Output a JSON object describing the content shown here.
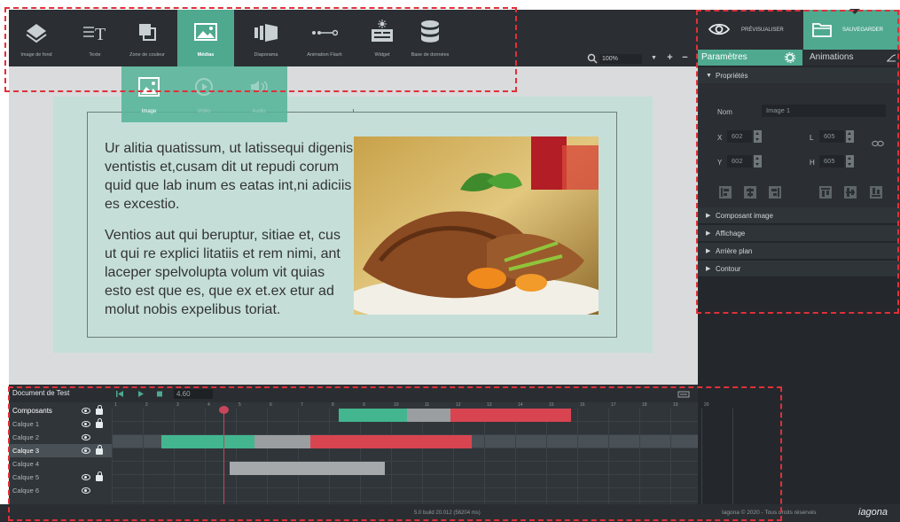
{
  "toolbar": {
    "tools": [
      {
        "label": "Image de fond",
        "icon": "layers-icon"
      },
      {
        "label": "Texte",
        "icon": "text-icon"
      },
      {
        "label": "Zone de couleur",
        "icon": "color-zone-icon"
      },
      {
        "label": "Médias",
        "icon": "media-icon"
      },
      {
        "label": "Diaporama",
        "icon": "slideshow-icon"
      },
      {
        "label": "Animation Flash",
        "icon": "flash-animation-icon"
      },
      {
        "label": "Widget",
        "icon": "widget-icon"
      },
      {
        "label": "Base de données",
        "icon": "database-icon"
      }
    ],
    "active_tool": "Médias",
    "zoom": "100%"
  },
  "media_submenu": {
    "items": [
      {
        "label": "Image",
        "icon": "image-icon"
      },
      {
        "label": "Vidéo",
        "icon": "video-icon"
      },
      {
        "label": "Audio",
        "icon": "audio-icon"
      }
    ]
  },
  "canvas": {
    "paragraph_1": "Ur alitia quatissum, ut latissequi digenis ventistis et,cusam dit ut repudi corum quid que lab inum es eatas int,ni adiciis es excestio.",
    "paragraph_2": "Ventios aut qui beruptur, sitiae et, cus ut qui re explici litatiis et rem nimi, ant laceper spelvolupta volum vit quias esto est que es, que ex et.ex etur ad molut nobis expelibus toriat."
  },
  "right_panel": {
    "preview_label": "PRÉVISUALISER",
    "save_label": "SAUVEGARDER",
    "tab_params": "Paramètres",
    "tab_animations": "Animations",
    "section_properties": "Propriétés",
    "name_label": "Nom",
    "name_value": "Image 1",
    "x_label": "X",
    "x_value": "602",
    "y_label": "Y",
    "y_value": "602",
    "l_label": "L",
    "l_value": "605",
    "h_label": "H",
    "h_value": "605",
    "sections": [
      "Composant image",
      "Affichage",
      "Arrière plan",
      "Contour"
    ]
  },
  "timeline": {
    "document_title": "Document de Test",
    "time_value": "4.60",
    "header_label": "Composants",
    "ruler": [
      "1",
      "2",
      "3",
      "4",
      "5",
      "6",
      "7",
      "8",
      "9",
      "10",
      "11",
      "12",
      "13",
      "14",
      "15",
      "16",
      "17",
      "18",
      "19",
      "20"
    ],
    "layers": [
      "Calque 1",
      "Calque 2",
      "Calque 3",
      "Calque 4",
      "Calque 5",
      "Calque 6"
    ],
    "playhead_time": 4.6,
    "bars": [
      {
        "layer": 0,
        "start": 8.3,
        "end": 10.5,
        "color": "#43b58f"
      },
      {
        "layer": 0,
        "start": 10.5,
        "end": 11.9,
        "color": "#9a9ea1"
      },
      {
        "layer": 0,
        "start": 11.9,
        "end": 15.8,
        "color": "#d84551"
      },
      {
        "layer": 2,
        "start": 2.6,
        "end": 5.6,
        "color": "#43b58f"
      },
      {
        "layer": 2,
        "start": 5.6,
        "end": 7.4,
        "color": "#9a9ea1"
      },
      {
        "layer": 2,
        "start": 7.4,
        "end": 12.6,
        "color": "#d84551"
      },
      {
        "layer": 4,
        "start": 4.8,
        "end": 9.8,
        "color": "#a5a9ac"
      }
    ]
  },
  "status": {
    "build": "5.0 build 20.012 (56204 ms)",
    "copyright": "Iagona © 2020 - Tous droits réservés",
    "brand": "iagona"
  },
  "colors": {
    "accent": "#4fa98f",
    "dark": "#2b2f33",
    "annotation": "#e0303a"
  }
}
